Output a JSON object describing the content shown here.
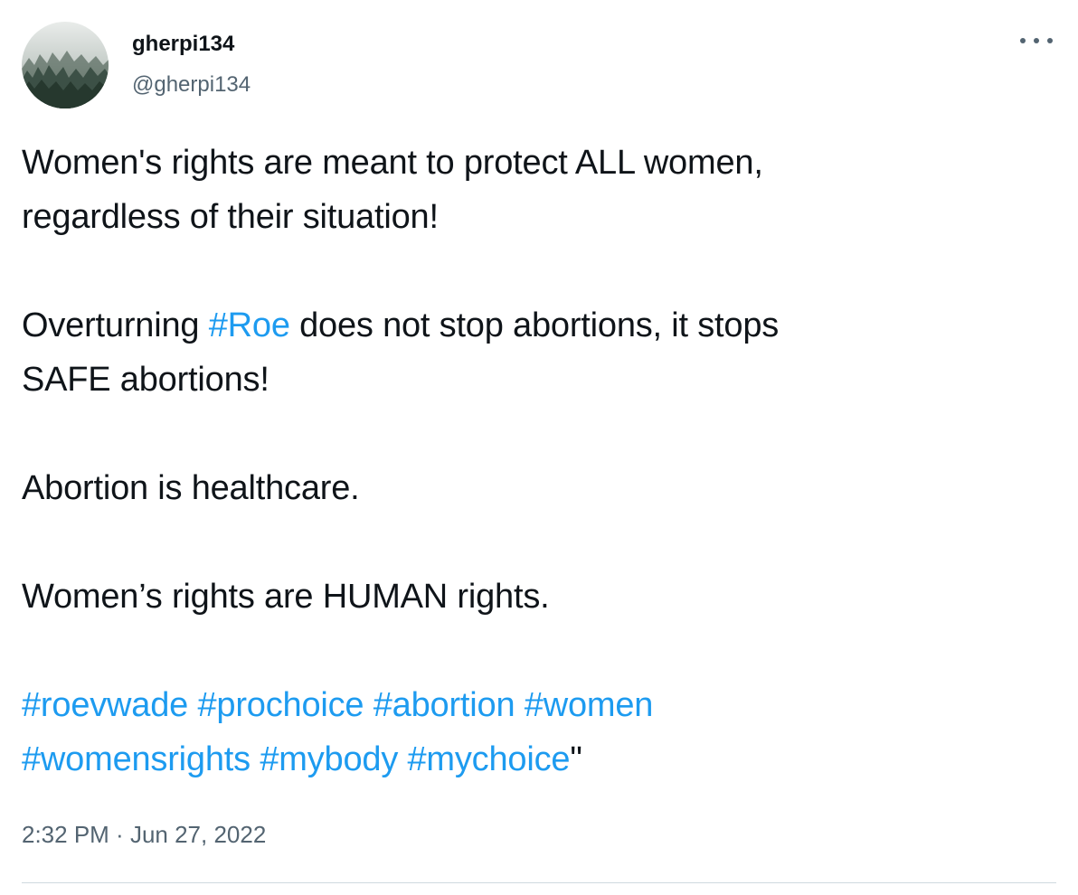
{
  "author": {
    "display_name": "gherpi134",
    "handle": "@gherpi134",
    "avatar_icon": "forest-avatar"
  },
  "menu_icon": "more-horizontal-icon",
  "tweet": {
    "line1": "Women's rights are meant to protect ALL women,",
    "line2": "regardless of their situation!",
    "line3_before": "Overturning ",
    "line3_tag": "#Roe",
    "line3_after": " does not stop abortions, it stops",
    "line4": "SAFE abortions!",
    "line5": "Abortion is healthcare.",
    "line6": "Women’s rights are HUMAN rights.",
    "hashtags_row1": [
      "#roevwade",
      "#prochoice",
      "#abortion",
      "#women"
    ],
    "hashtags_row2": [
      "#womensrights",
      "#mybody",
      "#mychoice"
    ],
    "trailing_quote": "\""
  },
  "meta": {
    "time": "2:32 PM",
    "separator": " · ",
    "date": "Jun 27, 2022"
  },
  "colors": {
    "link": "#1d9bf0",
    "text": "#0f1419",
    "secondary": "#536471",
    "divider": "#cfd9de"
  }
}
